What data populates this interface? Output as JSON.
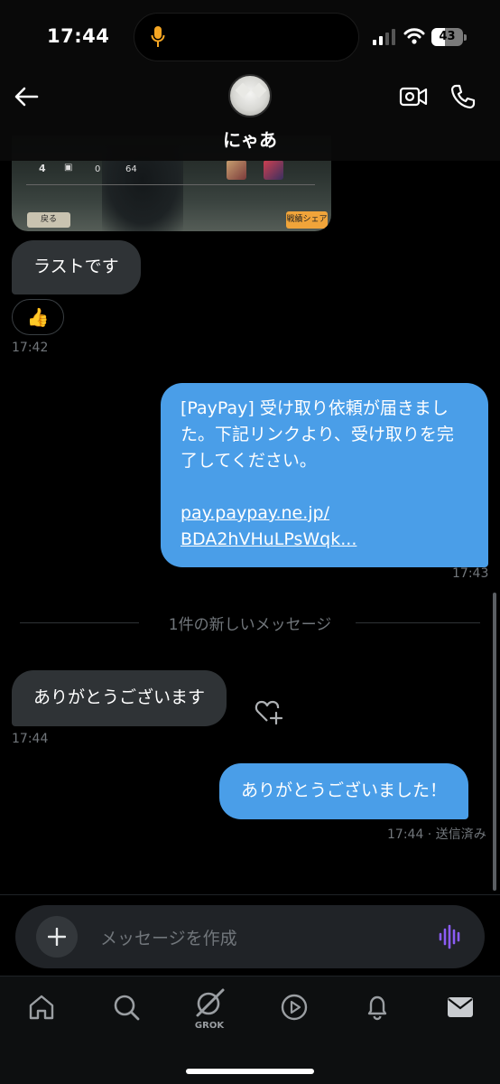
{
  "status_bar": {
    "time": "17:44",
    "battery_level": "43",
    "battery_fraction": 0.43
  },
  "header": {
    "contact_name": "にゃあ"
  },
  "media_preview": {
    "stats": [
      "4",
      "0",
      "64"
    ],
    "back_label": "戻る",
    "share_label": "戦績シェア"
  },
  "messages": [
    {
      "direction": "in",
      "text": "ラストです",
      "reaction": "👍",
      "time": "17:42"
    },
    {
      "direction": "out",
      "text": "[PayPay] 受け取り依頼が届きました。下記リンクより、受け取りを完了してください。",
      "link": "pay.paypay.ne.jp/\nBDA2hVHuLPsWqk...",
      "time": "17:43"
    },
    {
      "direction": "in",
      "text": "ありがとうございます",
      "time": "17:44"
    },
    {
      "direction": "out",
      "text": "ありがとうございました！",
      "time": "17:44 · 送信済み"
    }
  ],
  "divider_label": "1件の新しいメッセージ",
  "composer": {
    "placeholder": "メッセージを作成"
  },
  "tab_bar": {
    "grok_label": "GROK"
  },
  "colors": {
    "outgoing_bubble": "#4a9ee8",
    "incoming_bubble": "#2f3336",
    "voice_accent": "#8b5cf6",
    "mic_accent": "#f5a623"
  }
}
